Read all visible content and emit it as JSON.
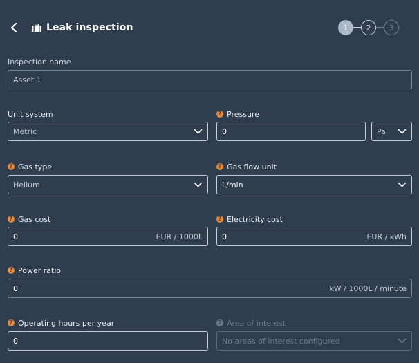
{
  "header": {
    "title": "Leak inspection",
    "steps": [
      "1",
      "2",
      "3"
    ]
  },
  "inspection_name": {
    "label": "Inspection name",
    "placeholder": "Asset 1"
  },
  "unit_system": {
    "label": "Unit system",
    "value": "Metric"
  },
  "pressure": {
    "label": "Pressure",
    "value": "0",
    "unit_value": "Pa"
  },
  "gas_type": {
    "label": "Gas type",
    "value": "Helium"
  },
  "gas_flow_unit": {
    "label": "Gas flow unit",
    "value": "L/min"
  },
  "gas_cost": {
    "label": "Gas cost",
    "value": "0",
    "unit": "EUR / 1000L"
  },
  "electricity_cost": {
    "label": "Electricity cost",
    "value": "0",
    "unit": "EUR / kWh"
  },
  "power_ratio": {
    "label": "Power ratio",
    "value": "0",
    "unit": "kW / 1000L / minute"
  },
  "operating_hours": {
    "label": "Operating hours per year",
    "value": "0"
  },
  "area_of_interest": {
    "label": "Area of interest",
    "value": "No areas of interest configured"
  },
  "icons": {
    "help": "?"
  },
  "colors": {
    "background": "#2f3e4f",
    "help_icon": "#e8893a",
    "step_active": "#a9b9c7"
  }
}
